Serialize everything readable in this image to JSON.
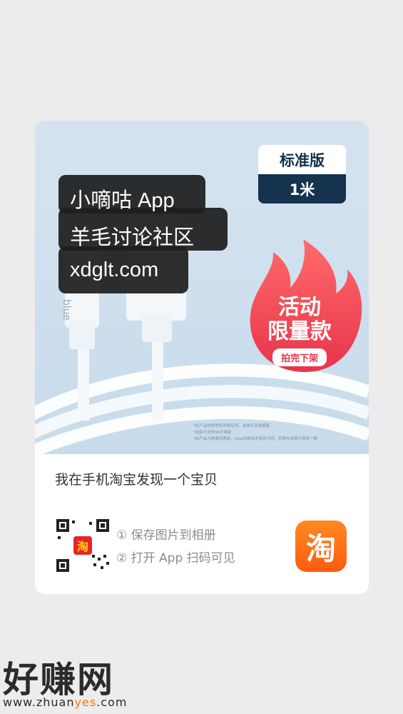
{
  "product": {
    "edition_label": "标准版",
    "edition_value": "1米",
    "flame_line1": "活动",
    "flame_line2": "限量款",
    "flame_pill": "拍完下架",
    "brand_text": "blue",
    "disclaimer": [
      "*此产品材质等和详情有异，具体可咨询客服",
      "*此款不支持90天换新",
      "*此产品为限量特惠款，logo印刷技术有所不同，实物与本图片保持一致"
    ]
  },
  "watermark": {
    "line1": "小嘀咕 App",
    "line2": "羊毛讨论社区",
    "line3": "xdglt.com"
  },
  "share": {
    "title": "我在手机淘宝发现一个宝贝",
    "step1": "① 保存图片到相册",
    "step2": "② 打开 App 扫码可见",
    "app_icon_char": "淘",
    "qr_logo_text": "淘"
  },
  "footer": {
    "site_name": "好赚网",
    "url_prefix": "www.zhuan",
    "url_highlight": "yes",
    "url_suffix": ".com"
  },
  "colors": {
    "background": "#ececec",
    "accent_orange": "#ff5a12",
    "flame_red": "#e8344a",
    "edition_navy": "#15334f"
  }
}
